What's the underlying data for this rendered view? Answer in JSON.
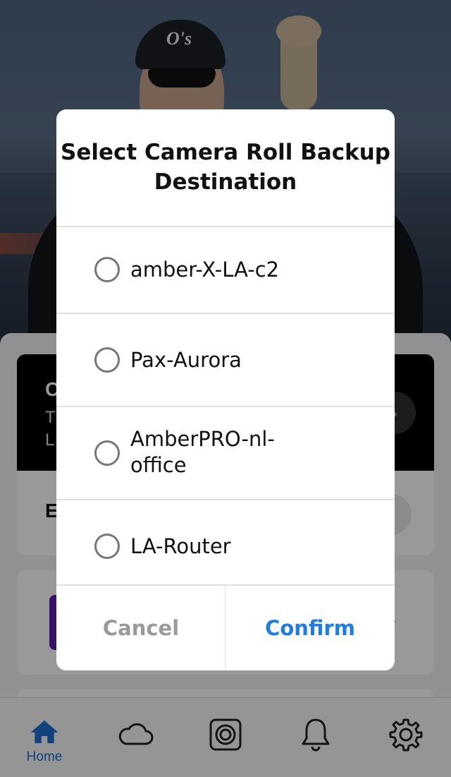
{
  "dialog": {
    "title": "Select Camera Roll Backup Destination",
    "options": [
      {
        "label": "amber-X-LA-c2",
        "selected": false
      },
      {
        "label": "Pax-Aurora",
        "selected": false
      },
      {
        "label": "AmberPRO-nl-office",
        "selected": false
      },
      {
        "label": "LA-Router",
        "selected": false
      }
    ],
    "cancel_label": "Cancel",
    "confirm_label": "Confirm"
  },
  "tabbar": {
    "items": [
      {
        "label": "Home",
        "icon": "home-icon",
        "active": true
      },
      {
        "label": "",
        "icon": "cloud-icon",
        "active": false
      },
      {
        "label": "",
        "icon": "camera-roll-icon",
        "active": false
      },
      {
        "label": "",
        "icon": "bell-icon",
        "active": false
      },
      {
        "label": "",
        "icon": "gear-icon",
        "active": false
      }
    ]
  },
  "colors": {
    "accent": "#1f7de0",
    "cancel_text": "#9a9a9a",
    "promo_card": "#000000"
  }
}
